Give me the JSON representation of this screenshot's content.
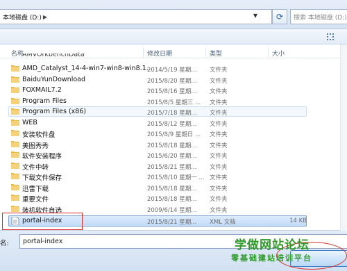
{
  "address": {
    "path_segment": "本地磁盘 (D:)",
    "search_placeholder": "搜索 本地磁盘 (D:)"
  },
  "columns": {
    "name": "名称",
    "date": "修改日期",
    "type": "类型",
    "size": "大小"
  },
  "files": [
    {
      "name": "AMD_Catalyst_14-4-win7-win8-win8.1...",
      "date": "2014/5/19 星期...",
      "type": "文件夹",
      "size": ""
    },
    {
      "name": "BaiduYunDownload",
      "date": "2015/8/20 星期...",
      "type": "文件夹",
      "size": ""
    },
    {
      "name": "FOXMAIL7.2",
      "date": "2015/8/16 星期...",
      "type": "文件夹",
      "size": ""
    },
    {
      "name": "Program Files",
      "date": "2015/8/5 星期三 ...",
      "type": "文件夹",
      "size": ""
    },
    {
      "name": "Program Files (x86)",
      "date": "2015/7/18 星期...",
      "type": "文件夹",
      "size": ""
    },
    {
      "name": "WEB",
      "date": "2015/8/12 星期...",
      "type": "文件夹",
      "size": ""
    },
    {
      "name": "安装软件盘",
      "date": "2015/8/9 星期日 ...",
      "type": "文件夹",
      "size": ""
    },
    {
      "name": "美图秀秀",
      "date": "2015/8/18 星期...",
      "type": "文件夹",
      "size": ""
    },
    {
      "name": "软件安装程序",
      "date": "2015/6/20 星期...",
      "type": "文件夹",
      "size": ""
    },
    {
      "name": "文件中转",
      "date": "2015/8/21 星期...",
      "type": "文件夹",
      "size": ""
    },
    {
      "name": "下载文件保存",
      "date": "2015/8/10 星期一 ...",
      "type": "文件夹",
      "size": ""
    },
    {
      "name": "迅雷下载",
      "date": "2015/8/18 星期...",
      "type": "文件夹",
      "size": ""
    },
    {
      "name": "重要文件",
      "date": "2015/8/18 星期...",
      "type": "文件夹",
      "size": ""
    },
    {
      "name": "装机软件自选",
      "date": "2009/6/14 星期...",
      "type": "文件夹",
      "size": ""
    },
    {
      "name": "portal-index",
      "date": "2015/8/21 星期...",
      "type": "XML 文档",
      "size": "14 KB"
    }
  ],
  "filename": {
    "label": "名:",
    "value": "portal-index"
  },
  "watermark": {
    "line1": "学做网站论坛",
    "line2": "零基础建站培训平台"
  },
  "icons": {
    "folder": "folder-icon",
    "xml": "xml-document-icon",
    "refresh": "refresh-icon",
    "search": "search-icon"
  },
  "colors": {
    "folder": "#e8b84a",
    "selection": "#c1dbfa",
    "watermark": "#2f9a2a",
    "annotation": "#d9302c"
  }
}
